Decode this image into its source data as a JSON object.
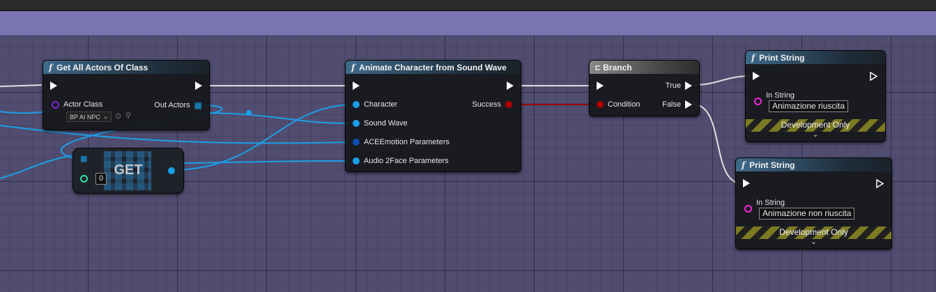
{
  "nodes": {
    "get_all_actors": {
      "title": "Get All Actors Of Class",
      "actor_class_label": "Actor Class",
      "actor_class_value": "BP AI NPC",
      "out_actors_label": "Out Actors"
    },
    "get": {
      "title": "GET",
      "index_value": "0"
    },
    "animate": {
      "title": "Animate Character from Sound Wave",
      "pins": [
        "Character",
        "Sound Wave",
        "ACEEmotion Parameters",
        "Audio 2Face Parameters"
      ],
      "success_label": "Success"
    },
    "branch": {
      "title": "Branch",
      "condition_label": "Condition",
      "true_label": "True",
      "false_label": "False"
    },
    "print_success": {
      "title": "Print String",
      "in_string_label": "In String",
      "in_string_value": "Animazione riuscita",
      "footer": "Development Only"
    },
    "print_fail": {
      "title": "Print String",
      "in_string_label": "In String",
      "in_string_value": "Animazione non riuscita",
      "footer": "Development Only"
    }
  },
  "colors": {
    "graph_background": "#514d70",
    "comment_band": "#7b74b2",
    "object_wire": "#1aa0e8",
    "exec_wire": "#e0e0e0",
    "bool_wire": "#9a0000",
    "string_pin": "#f02ad6",
    "class_pin": "#7a2ad6",
    "int_pin": "#2ee0a0"
  },
  "icons": {
    "function": "function-icon",
    "branch": "branch-icon",
    "array": "array-grid-icon",
    "dropdown": "chevron-down-icon",
    "browse": "browse-icon",
    "search": "search-icon",
    "expand": "chevron-down-icon"
  }
}
